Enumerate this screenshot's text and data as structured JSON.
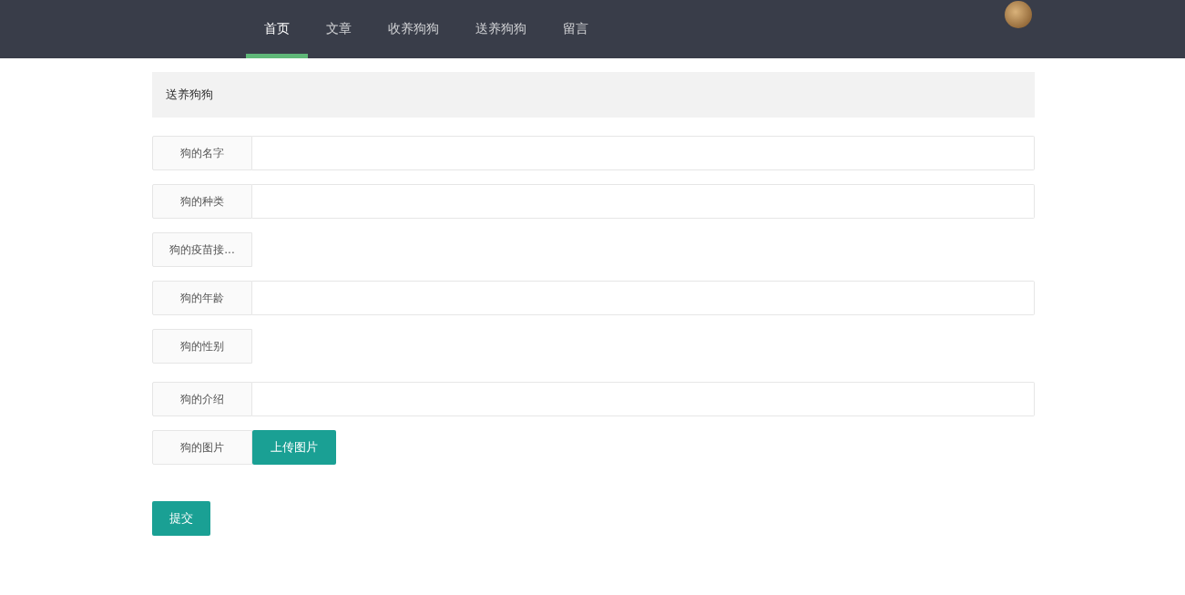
{
  "nav": {
    "items": [
      {
        "label": "首页",
        "selected": true
      },
      {
        "label": "文章",
        "selected": false
      },
      {
        "label": "收养狗狗",
        "selected": false
      },
      {
        "label": "送养狗狗",
        "selected": false
      },
      {
        "label": "留言",
        "selected": false
      }
    ]
  },
  "form": {
    "title": "送养狗狗",
    "fields": [
      {
        "kind": "text",
        "label": "狗的名字"
      },
      {
        "kind": "text",
        "label": "狗的种类"
      },
      {
        "kind": "empty",
        "label": "狗的疫苗接..."
      },
      {
        "kind": "text",
        "label": "狗的年龄"
      },
      {
        "kind": "empty",
        "label": "狗的性别"
      },
      {
        "kind": "text",
        "label": "狗的介绍"
      },
      {
        "kind": "upload",
        "label": "狗的图片",
        "button": "上传图片"
      }
    ],
    "submit": "提交"
  }
}
